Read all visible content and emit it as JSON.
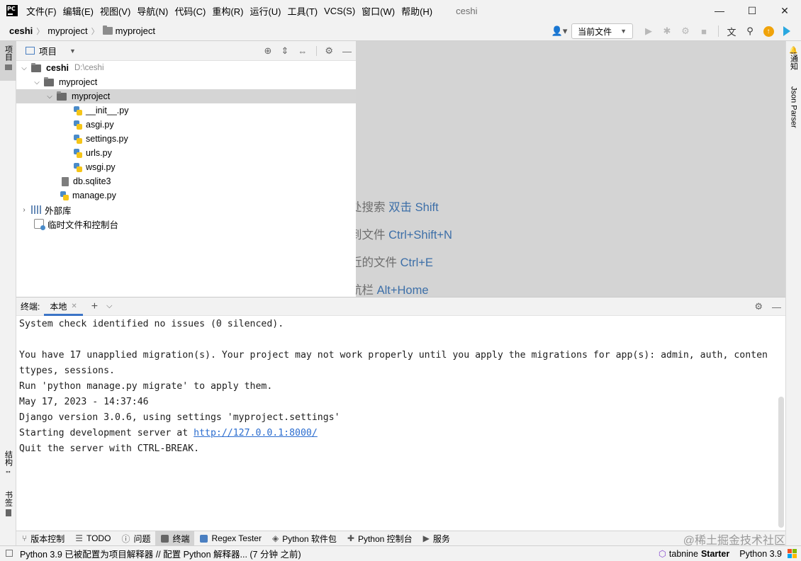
{
  "app": {
    "logo_text": "PC",
    "window_title": "ceshi",
    "menu": [
      "文件(F)",
      "编辑(E)",
      "视图(V)",
      "导航(N)",
      "代码(C)",
      "重构(R)",
      "运行(U)",
      "工具(T)",
      "VCS(S)",
      "窗口(W)",
      "帮助(H)"
    ],
    "window_buttons": {
      "minimize": "—",
      "maximize": "☐",
      "close": "✕"
    }
  },
  "navbar": {
    "breadcrumbs": [
      "ceshi",
      "myproject",
      "myproject"
    ],
    "run_config": "当前文件"
  },
  "left_strip": {
    "project_tab": "项目",
    "structure_tab": "结构",
    "bookmarks_tab": "书签"
  },
  "right_strip": {
    "notifications_tab": "通知",
    "json_parser_tab": "Json Parser"
  },
  "project_panel": {
    "title": "项目",
    "tree": [
      {
        "label": "ceshi",
        "path": "D:\\ceshi",
        "type": "folder",
        "level": 0,
        "expanded": true
      },
      {
        "label": "myproject",
        "type": "folder",
        "level": 1,
        "expanded": true
      },
      {
        "label": "myproject",
        "type": "package",
        "level": 2,
        "expanded": true,
        "selected": true
      },
      {
        "label": "__init__.py",
        "type": "py",
        "level": 4
      },
      {
        "label": "asgi.py",
        "type": "py",
        "level": 4
      },
      {
        "label": "settings.py",
        "type": "py",
        "level": 4
      },
      {
        "label": "urls.py",
        "type": "py",
        "level": 4
      },
      {
        "label": "wsgi.py",
        "type": "py",
        "level": 4
      },
      {
        "label": "db.sqlite3",
        "type": "db",
        "level": 3
      },
      {
        "label": "manage.py",
        "type": "py",
        "level": 3
      },
      {
        "label": "外部库",
        "type": "lib",
        "level": 0,
        "expanded": false
      },
      {
        "label": "临时文件和控制台",
        "type": "scratch",
        "level": 0
      }
    ]
  },
  "editor_hints": [
    {
      "text": "处搜索 ",
      "key": "双击 Shift"
    },
    {
      "text": "到文件 ",
      "key": "Ctrl+Shift+N"
    },
    {
      "text": "近的文件 ",
      "key": "Ctrl+E"
    },
    {
      "text": "航栏 ",
      "key": "Alt+Home"
    }
  ],
  "terminal": {
    "title": "终端:",
    "tab": "本地",
    "lines": [
      "System check identified no issues (0 silenced).",
      "",
      "You have 17 unapplied migration(s). Your project may not work properly until you apply the migrations for app(s): admin, auth, conten",
      "ttypes, sessions.",
      "Run 'python manage.py migrate' to apply them.",
      "May 17, 2023 - 14:37:46",
      "Django version 3.0.6, using settings 'myproject.settings'"
    ],
    "server_prefix": "Starting development server at ",
    "server_url": "http://127.0.0.1:8000/",
    "quit_line": "Quit the server with CTRL-BREAK."
  },
  "bottom_tabs": [
    "版本控制",
    "TODO",
    "问题",
    "终端",
    "Regex Tester",
    "Python 软件包",
    "Python 控制台",
    "服务"
  ],
  "watermark": "@稀土掘金技术社区",
  "statusbar": {
    "message": "Python 3.9 已被配置为项目解释器 // 配置 Python 解释器... (7 分钟 之前)",
    "tabnine": "tabnine",
    "tabnine_plan": "Starter",
    "interpreter": "Python 3.9"
  }
}
